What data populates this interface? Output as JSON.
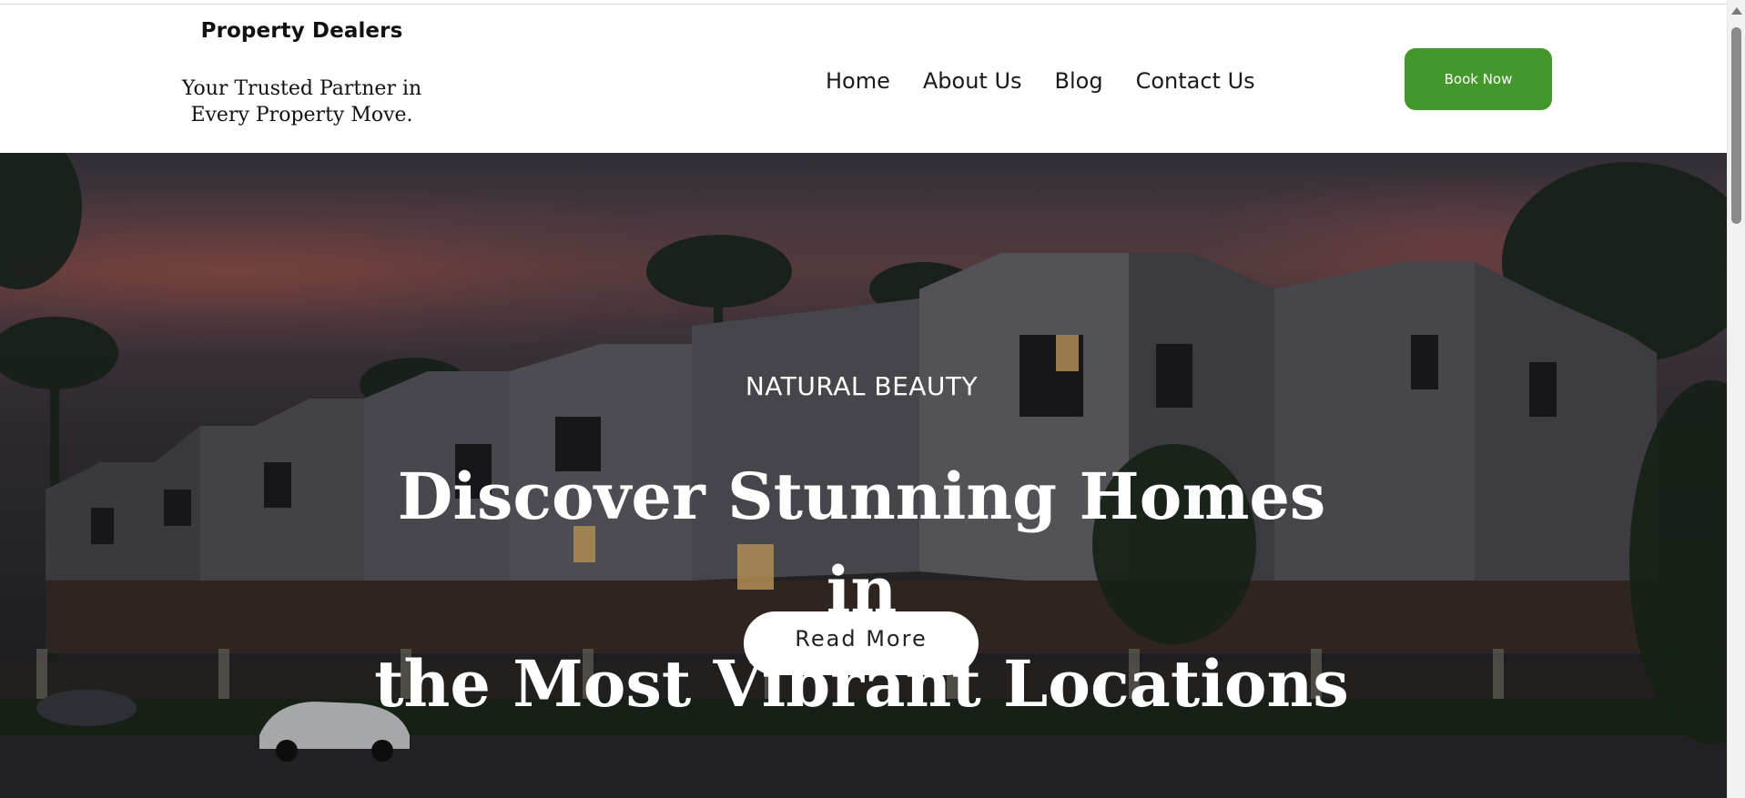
{
  "header": {
    "brand_name": "Property Dealers",
    "tagline_line1": "Your Trusted Partner in",
    "tagline_line2": "Every Property Move.",
    "nav": [
      {
        "label": "Home"
      },
      {
        "label": "About Us"
      },
      {
        "label": "Blog"
      },
      {
        "label": "Contact Us"
      }
    ],
    "cta_label": "Book Now"
  },
  "hero": {
    "eyebrow": "NATURAL BEAUTY",
    "title_line1": "Discover Stunning Homes",
    "title_line2": "in",
    "title_line3": "the Most Vibrant Locations",
    "button_label": "Read More",
    "background_image": "townhouse-street-at-dusk"
  },
  "colors": {
    "accent_green": "#44972a",
    "hero_text": "#ffffff",
    "header_background": "#ffffff"
  },
  "icons": {
    "scroll_up": "chevron-up-icon"
  }
}
